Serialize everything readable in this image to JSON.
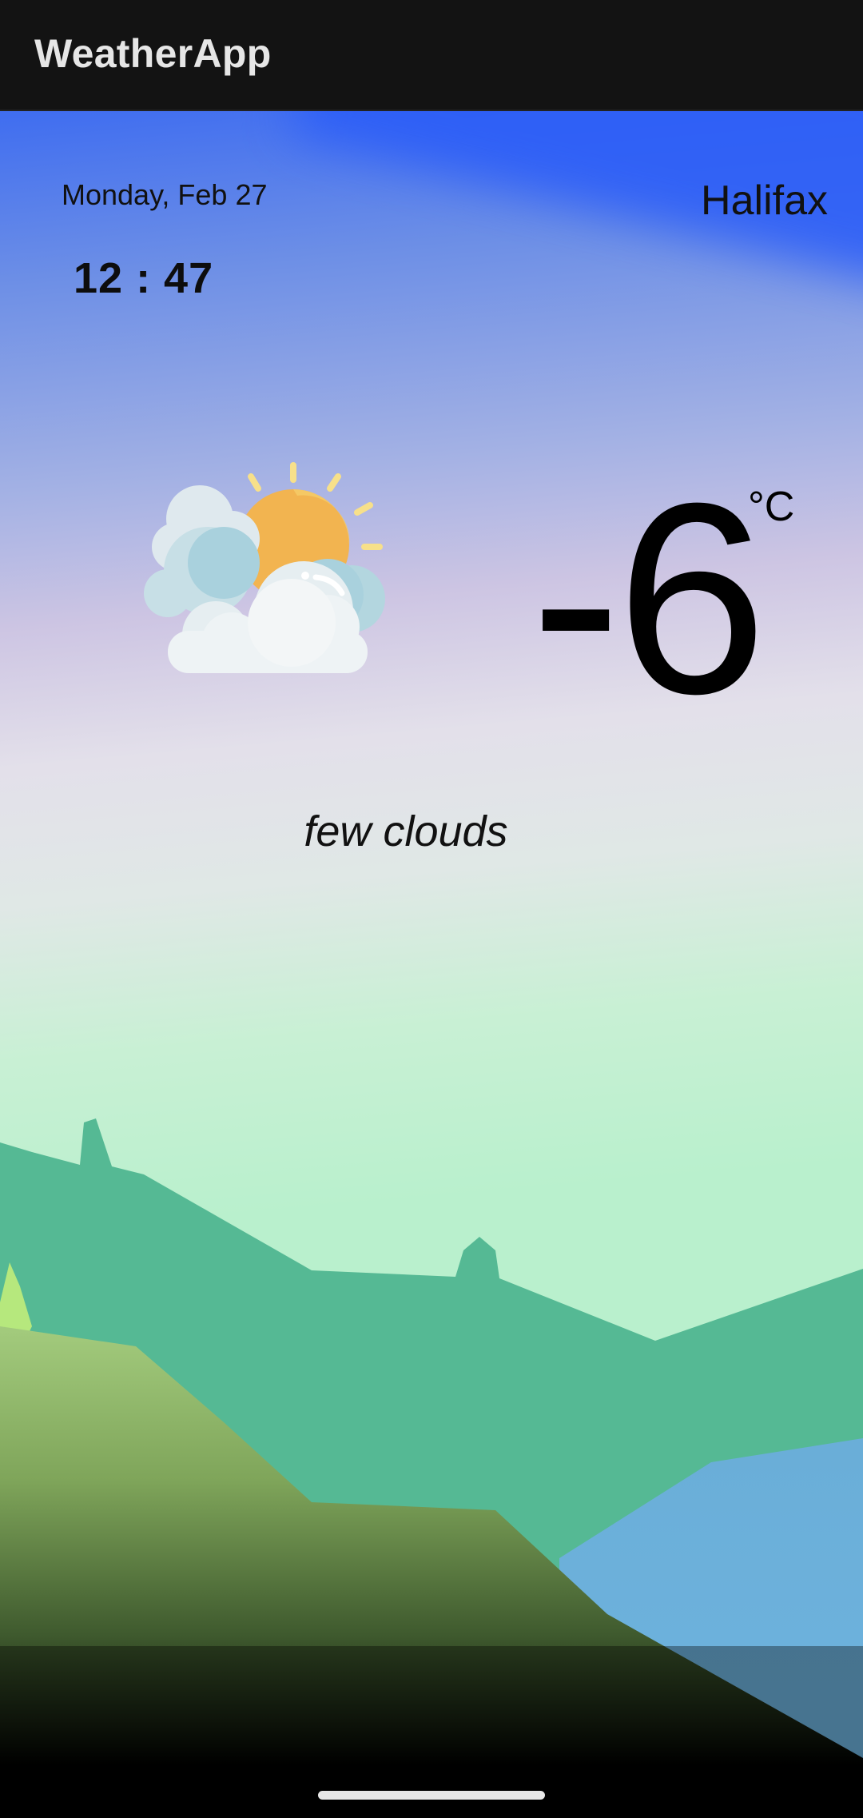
{
  "app_bar": {
    "title": "WeatherApp"
  },
  "weather": {
    "date": "Monday, Feb 27",
    "time": "12 : 47",
    "city": "Halifax",
    "temperature": "-6",
    "unit": "°C",
    "condition": "few clouds",
    "icon": "partly-cloudy-icon"
  },
  "colors": {
    "app_bar_bg": "#131313",
    "sky_top": "#3f6df0",
    "sky_bottom": "#b9f0cd",
    "hills_dark": "#55b994",
    "hills_green": "#9cc57a",
    "water": "#6aaed8",
    "sun": "#f2b450"
  }
}
